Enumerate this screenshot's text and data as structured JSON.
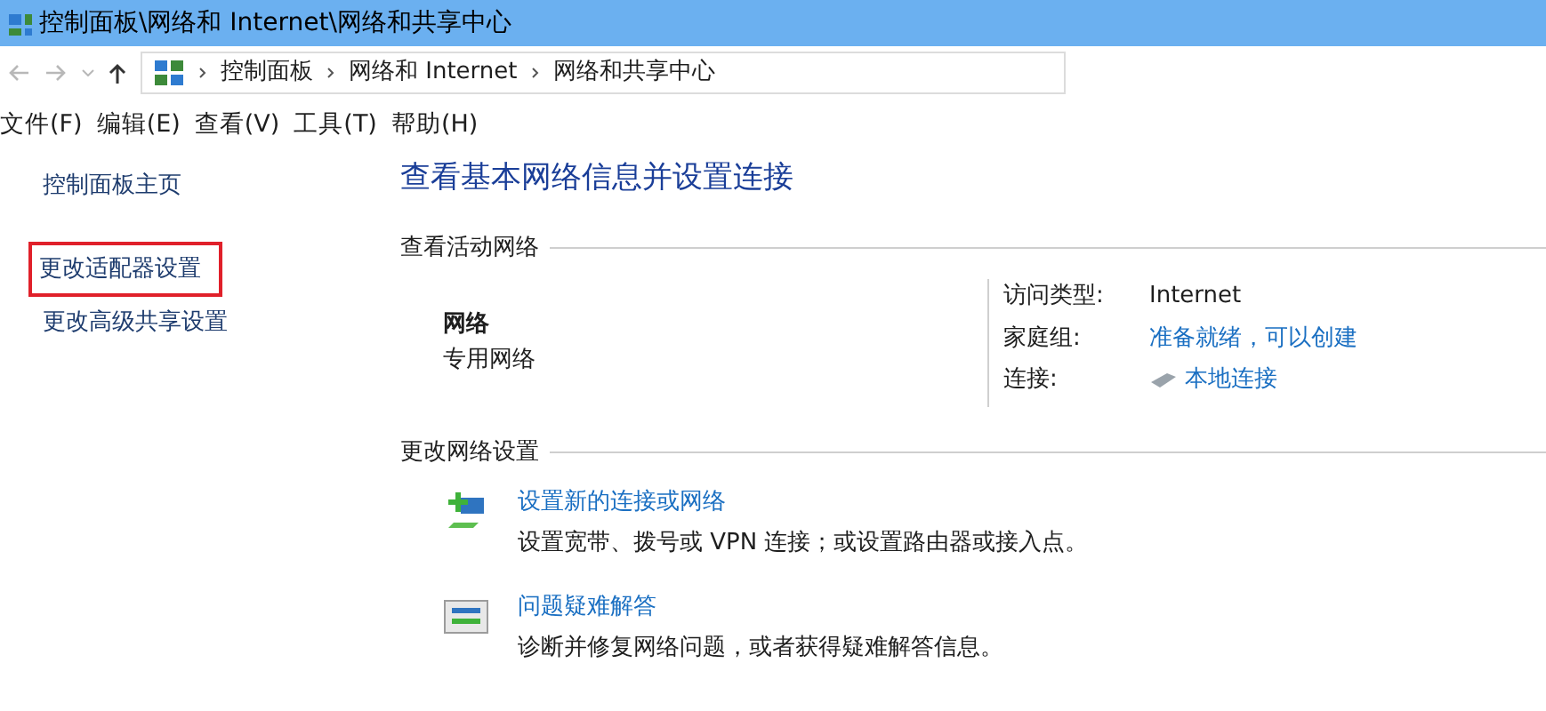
{
  "window": {
    "title": "控制面板\\网络和 Internet\\网络和共享中心"
  },
  "address_bar": {
    "crumbs": [
      "控制面板",
      "网络和 Internet",
      "网络和共享中心"
    ]
  },
  "menu": [
    "文件(F)",
    "编辑(E)",
    "查看(V)",
    "工具(T)",
    "帮助(H)"
  ],
  "sidebar": {
    "items": [
      {
        "label": "控制面板主页",
        "highlighted": false
      },
      {
        "label": "更改适配器设置",
        "highlighted": true
      },
      {
        "label": "更改高级共享设置",
        "highlighted": false
      }
    ]
  },
  "heading": "查看基本网络信息并设置连接",
  "active_networks": {
    "title": "查看活动网络",
    "name": "网络",
    "category": "专用网络",
    "properties": [
      {
        "label": "访问类型:",
        "value": "Internet",
        "kind": "text"
      },
      {
        "label": "家庭组:",
        "value": "准备就绪，可以创建",
        "kind": "link"
      },
      {
        "label": "连接:",
        "value": "本地连接",
        "kind": "connection"
      }
    ]
  },
  "change_settings": {
    "title": "更改网络设置",
    "tasks": [
      {
        "kind": "new-connection",
        "link": "设置新的连接或网络",
        "description": "设置宽带、拨号或 VPN 连接；或设置路由器或接入点。"
      },
      {
        "kind": "troubleshoot",
        "link": "问题疑难解答",
        "description": "诊断并修复网络问题，或者获得疑难解答信息。"
      }
    ]
  }
}
